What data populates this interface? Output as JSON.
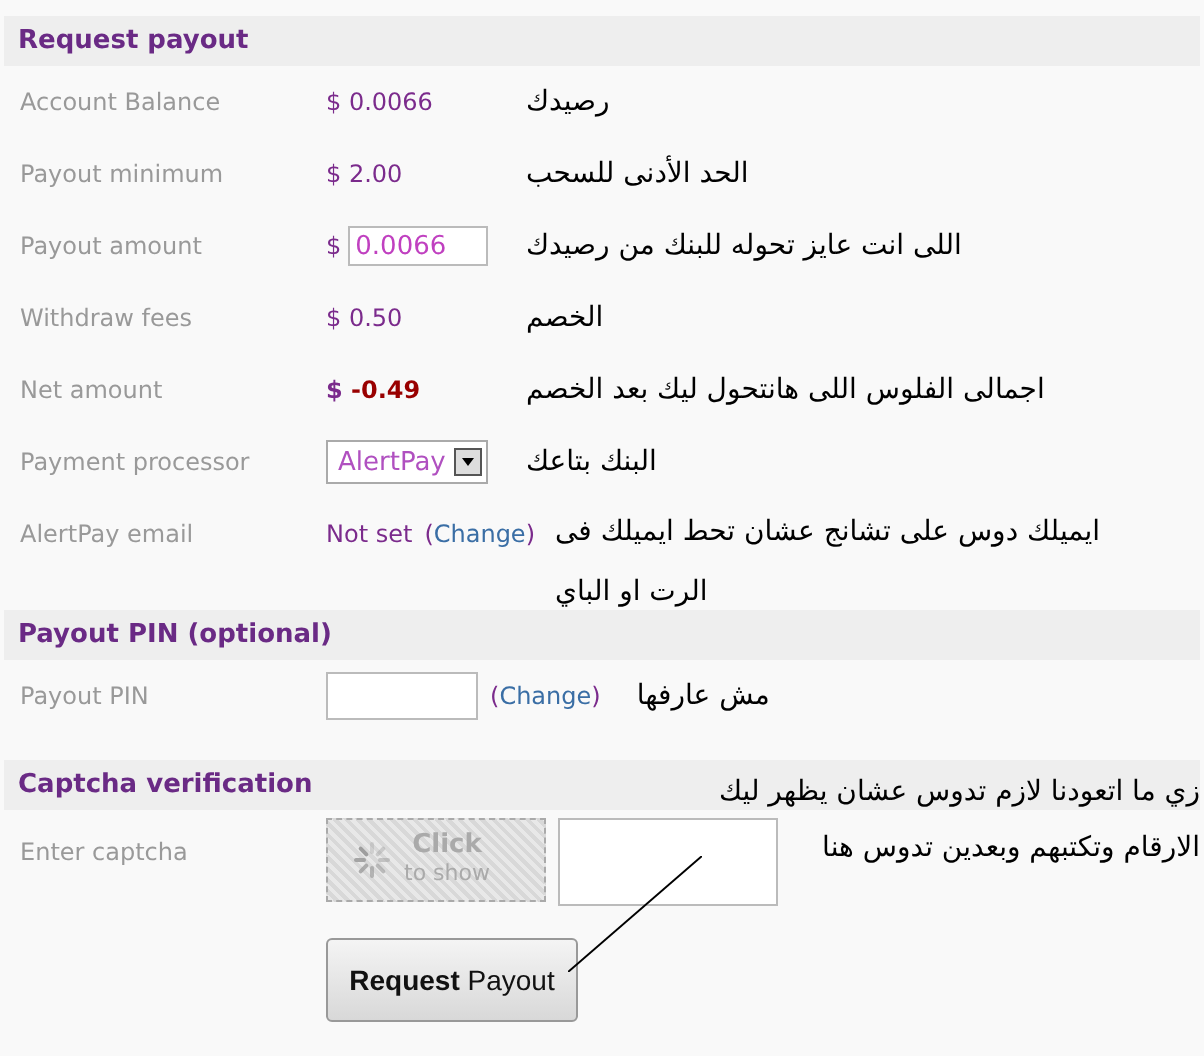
{
  "sections": [
    {
      "title": "Request payout",
      "rows": [
        {
          "label": "Account Balance",
          "kind": "amount",
          "currency": "$",
          "value": "0.0066",
          "note": "رصيدك"
        },
        {
          "label": "Payout minimum",
          "kind": "amount",
          "currency": "$",
          "value": "2.00",
          "note": "الحد الأدنى للسحب"
        },
        {
          "label": "Payout amount",
          "kind": "input",
          "currency": "$",
          "value": "0.0066",
          "note": "اللى انت عايز تحوله للبنك من رصيدك"
        },
        {
          "label": "Withdraw fees",
          "kind": "amount",
          "currency": "$",
          "value": "0.50",
          "note": "الخصم"
        },
        {
          "label": "Net amount",
          "kind": "negative",
          "currency": "$",
          "value": "-0.49",
          "note": "اجمالى الفلوس اللى هانتحول ليك بعد الخصم"
        },
        {
          "label": "Payment processor",
          "kind": "select",
          "value": "AlertPay",
          "note": "البنك بتاعك"
        },
        {
          "label": "AlertPay email",
          "kind": "link",
          "value": "Not set",
          "paren_open": "(",
          "link": "Change",
          "paren_close": ")",
          "note": "ايميلك دوس على تشانج عشان تحط ايميلك فى الرت او الباي"
        }
      ]
    },
    {
      "title": "Payout PIN (optional)",
      "rows": [
        {
          "label": "Payout PIN",
          "kind": "pin",
          "paren_open": "(",
          "link": "Change",
          "paren_close": ")",
          "note": "مش عارفها"
        }
      ]
    },
    {
      "title": "Captcha verification",
      "note": "زي ما اتعودنا لازم تدوس عشان يظهر ليك الارقام وتكتبهم وبعدين تدوس هنا",
      "rows": [
        {
          "label": "Enter captcha",
          "kind": "captcha",
          "captcha_title": "Click",
          "captcha_subtitle": "to show"
        }
      ]
    }
  ],
  "button": "**Request** Payout"
}
